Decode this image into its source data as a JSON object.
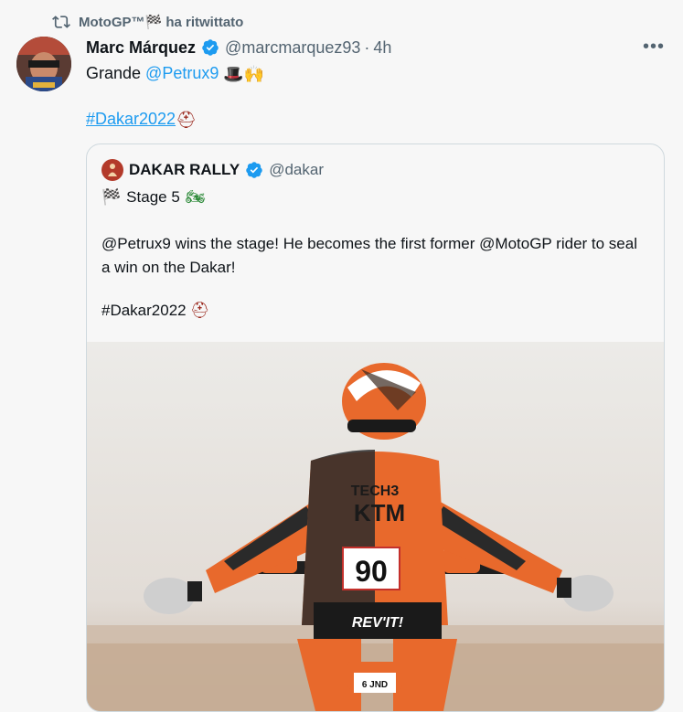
{
  "retweet": {
    "label": "MotoGP™🏁 ha ritwittato"
  },
  "tweet": {
    "author_name": "Marc Márquez",
    "handle": "@marcmarquez93",
    "separator": "·",
    "time": "4h",
    "more_label": "•••",
    "text_prefix": "Grande ",
    "mention": "@Petrux9",
    "emojis": "🎩🙌",
    "hashtag": "#Dakar2022",
    "hashtag_emoji": "⛑"
  },
  "quoted": {
    "name": "DAKAR RALLY",
    "handle": "@dakar",
    "stage_flag": "🏁",
    "stage_label": "Stage 5",
    "stage_emoji": "🏍",
    "body": "@Petrux9 wins the stage! He becomes the first former @MotoGP rider to seal a win on the Dakar!",
    "hashtag": "#Dakar2022",
    "hashtag_emoji": "⛑",
    "photo": {
      "jersey_brand": "KTM",
      "team": "TECH3",
      "number": "90",
      "pants_brand": "REV'IT!",
      "plate": "6 JND"
    }
  },
  "colors": {
    "link": "#1d9bf0",
    "verified": "#1d9bf0",
    "muted": "#536471",
    "ktm_orange": "#e8692c"
  }
}
